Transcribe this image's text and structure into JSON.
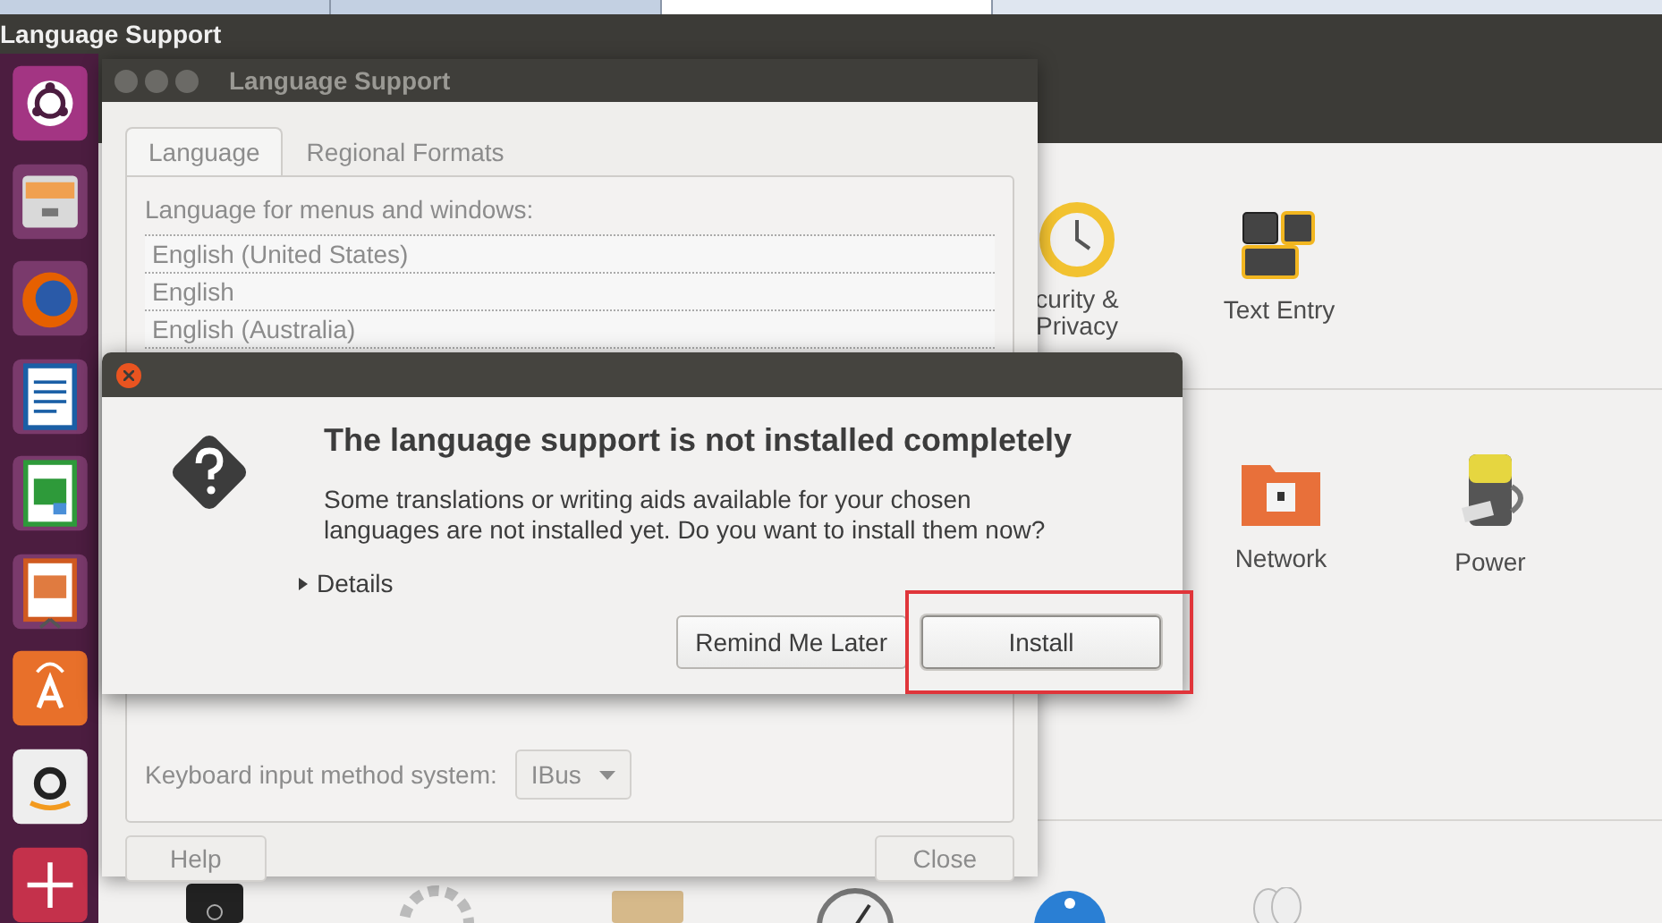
{
  "browser_tabs": [
    {
      "selected": false
    },
    {
      "selected": false
    },
    {
      "selected": true
    }
  ],
  "top_panel": {
    "title": "Language Support"
  },
  "settings": {
    "items": [
      {
        "label": "curity & Privacy"
      },
      {
        "label": "Text Entry"
      },
      {
        "label": "Network"
      },
      {
        "label": "Power"
      }
    ]
  },
  "language_window": {
    "title": "Language Support",
    "tabs": [
      {
        "label": "Language",
        "selected": true
      },
      {
        "label": "Regional Formats",
        "selected": false
      }
    ],
    "list_label": "Language for menus and windows:",
    "languages": [
      "English (United States)",
      "English",
      "English (Australia)"
    ],
    "input_method": {
      "label": "Keyboard input method system:",
      "value": "IBus"
    },
    "buttons": [
      "Help",
      "Close"
    ]
  },
  "dialog": {
    "title": "The language support is not installed completely",
    "message": "Some translations or writing aids available for your chosen languages are not installed yet. Do you want to install them now?",
    "details": {
      "label": "Details",
      "expanded": false
    },
    "buttons": [
      {
        "label": "Remind Me Later",
        "highlighted": false
      },
      {
        "label": "Install",
        "highlighted": true
      }
    ]
  }
}
